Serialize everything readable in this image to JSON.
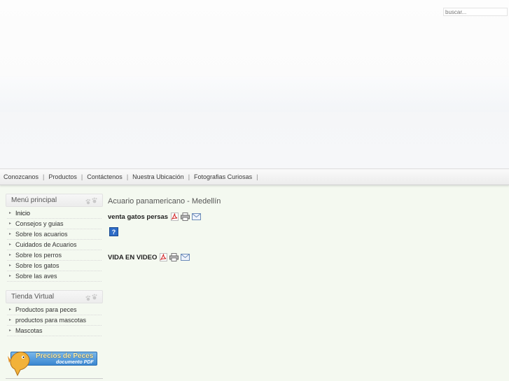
{
  "search": {
    "placeholder": "buscar..."
  },
  "topnav": {
    "items": [
      "Conozcanos",
      "Productos",
      "Contáctenos",
      "Nuestra Ubicación",
      "Fotografias Curiosas"
    ]
  },
  "sidebar": {
    "main_menu": {
      "title": "Menú principal",
      "items": [
        "Inicio",
        "Consejos y guias",
        "Sobre los acuarios",
        "Cuidados de Acuarios",
        "Sobre los perros",
        "Sobre los gatos",
        "Sobre las aves"
      ]
    },
    "store_menu": {
      "title": "Tienda Virtual",
      "items": [
        "Productos para peces",
        "productos para mascotas",
        "Mascotas"
      ]
    },
    "banner": {
      "title": "Precios de Peces",
      "subtitle": "documento PDF"
    }
  },
  "content": {
    "page_title": "Acuario panamericano - Medellín",
    "articles": [
      {
        "title": "venta gatos persas"
      },
      {
        "title": "VIDA EN VIDEO"
      }
    ]
  },
  "icons": [
    "pdf-icon",
    "print-icon",
    "email-icon",
    "help-icon",
    "paw-icon",
    "fish-icon",
    "arrow-right-icon"
  ],
  "colors": {
    "page_bg": "#f4f9f0",
    "banner_blue": "#3a86d1",
    "pdf_red": "#d22a2a"
  }
}
